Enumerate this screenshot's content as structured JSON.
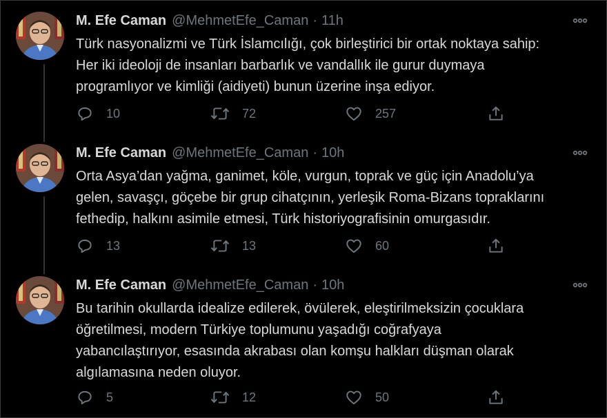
{
  "tweets": [
    {
      "display_name": "M. Efe Caman",
      "handle": "@MehmetEfe_Caman",
      "separator": "·",
      "time": "11h",
      "text_lines": [
        "Türk nasyonalizmi ve Türk İslamcılığı, çok birleştirici bir ortak noktaya sahip:",
        "Her iki ideoloji de insanları barbarlık ve vandallık ile gurur duymaya",
        "programlıyor ve kimliği (aidiyeti) bunun üzerine inşa ediyor."
      ],
      "replies": "10",
      "retweets": "72",
      "likes": "257"
    },
    {
      "display_name": "M. Efe Caman",
      "handle": "@MehmetEfe_Caman",
      "separator": "·",
      "time": "10h",
      "text_lines": [
        "Orta Asya’dan yağma, ganimet, köle, vurgun, toprak ve güç için Anadolu’ya",
        "gelen, savaşçı, göçebe bir grup cihatçının, yerleşik Roma-Bizans topraklarını",
        "fethedip, halkını asimile etmesi, Türk historiyografisinin omurgasıdır."
      ],
      "replies": "13",
      "retweets": "13",
      "likes": "60"
    },
    {
      "display_name": "M. Efe Caman",
      "handle": "@MehmetEfe_Caman",
      "separator": "·",
      "time": "10h",
      "text_lines": [
        "Bu tarihin okullarda idealize edilerek, övülerek, eleştirilmeksizin çocuklara",
        "öğretilmesi, modern Türkiye toplumunu yaşadığı coğrafyaya",
        "yabancılaştırıyor, esasında akrabası olan komşu halkları düşman olarak",
        "algılamasına neden oluyor."
      ],
      "replies": "5",
      "retweets": "12",
      "likes": "50"
    }
  ],
  "icons": {
    "reply": "reply-icon",
    "retweet": "retweet-icon",
    "like": "heart-icon",
    "share": "share-icon",
    "more": "more-icon"
  },
  "colors": {
    "background": "#000000",
    "text": "#d9d9d9",
    "muted": "#6e767d",
    "thread_line": "#333639"
  }
}
